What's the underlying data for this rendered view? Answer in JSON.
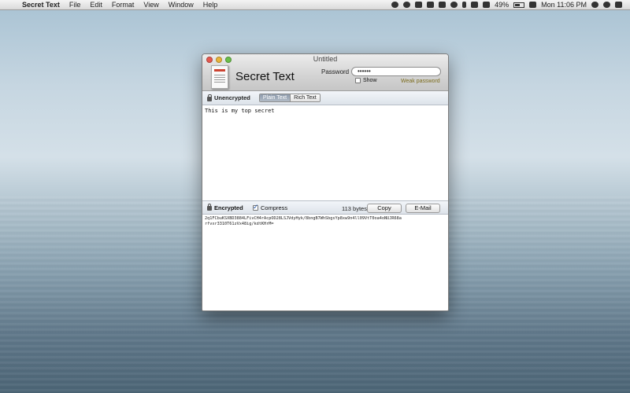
{
  "menubar": {
    "app_name": "Secret Text",
    "menus": [
      "File",
      "Edit",
      "Format",
      "View",
      "Window",
      "Help"
    ],
    "battery": "49%",
    "clock": "Mon 11:06 PM"
  },
  "window": {
    "title": "Untitled",
    "app_title": "Secret Text",
    "password_label": "Password",
    "password_value": "••••••",
    "show_label": "Show",
    "password_strength": "Weak password"
  },
  "unencrypted": {
    "label": "Unencrypted",
    "modes": [
      "Plain Text",
      "Rich Text"
    ],
    "active_mode": "Plain Text",
    "text": "This is my top secret"
  },
  "encrypted": {
    "label": "Encrypted",
    "compress_label": "Compress",
    "compress_checked": true,
    "bytes": "113 bytes",
    "copy_label": "Copy",
    "email_label": "E-Mail",
    "lines": [
      "2q1FCbuKSXBD3884LFivCH4rAcpOD28LSJVdyHyk/8bngB7WhSbgsYp8xw9n4ll09VtT0oa4oNUJR68a",
      "rfvxr3310T61zVx48ig/kdtKHrM="
    ]
  }
}
